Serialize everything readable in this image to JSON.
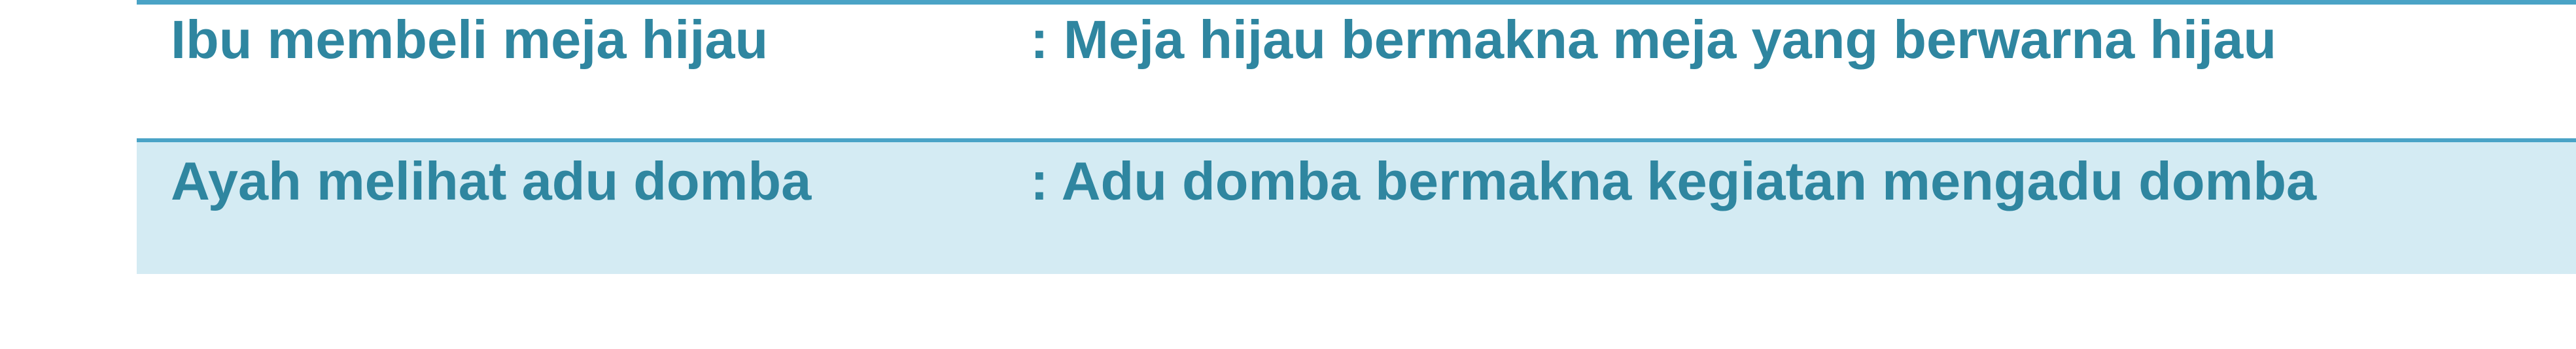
{
  "table": {
    "rows": [
      {
        "sentence": "Ibu membeli meja hijau",
        "meaning": ": Meja hijau bermakna meja yang berwarna hijau"
      },
      {
        "sentence": "Ayah melihat adu domba",
        "meaning": ": Adu domba bermakna kegiatan mengadu domba"
      }
    ]
  },
  "colors": {
    "text": "#2f86a0",
    "border": "#4aa3c6",
    "row_alt_background": "#d4ebf3"
  }
}
